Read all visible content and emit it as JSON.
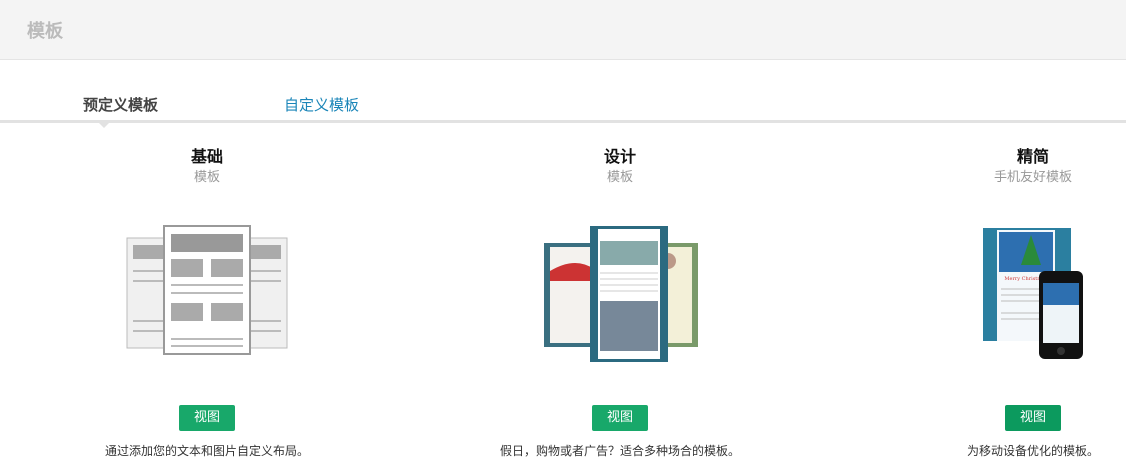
{
  "header": {
    "title": "模板"
  },
  "tabs": [
    {
      "label": "预定义模板",
      "active": true
    },
    {
      "label": "自定义模板",
      "active": false
    }
  ],
  "cards": [
    {
      "title": "基础",
      "subtitle": "模板",
      "button": "视图",
      "description": "通过添加您的文本和图片自定义布局。",
      "icon": "basic-layout-icon"
    },
    {
      "title": "设计",
      "subtitle": "模板",
      "button": "视图",
      "description": "假日，购物或者广告？适合多种场合的模板。",
      "icon": "design-templates-icon"
    },
    {
      "title": "精简",
      "subtitle": "手机友好模板",
      "button": "视图",
      "description": "为移动设备优化的模板。",
      "icon": "mobile-template-icon",
      "thumb_text": "Merry Christmas"
    }
  ],
  "colors": {
    "button": "#18a86a",
    "link": "#1a85b8"
  }
}
